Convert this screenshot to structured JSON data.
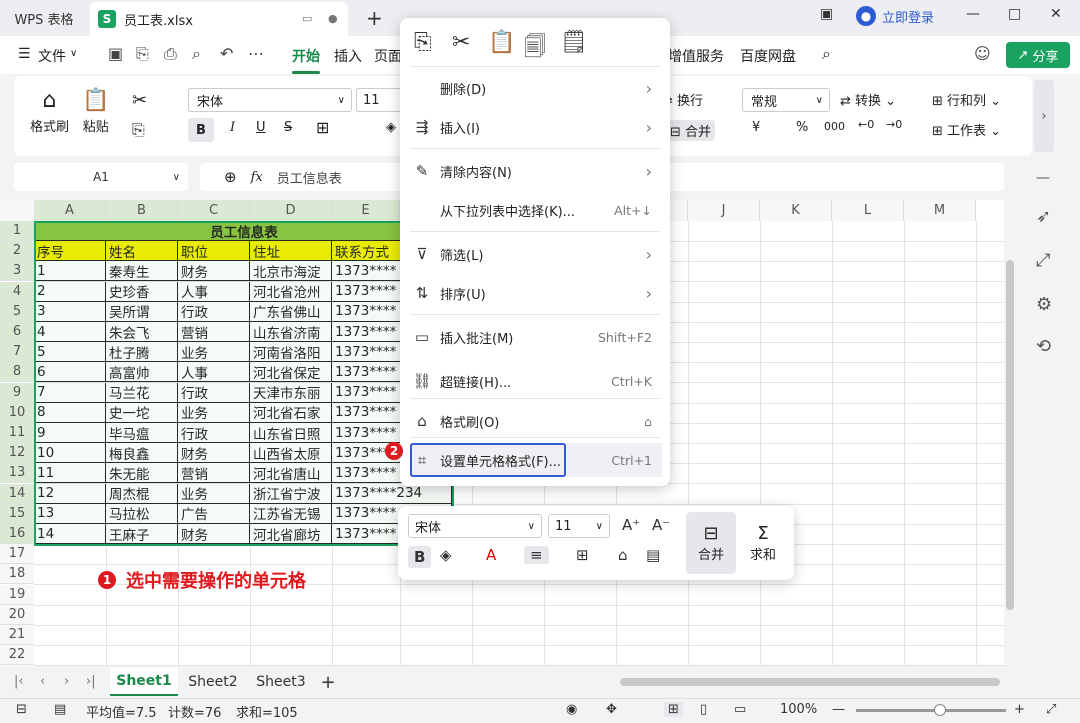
{
  "titlebar": {
    "app_tab": "WPS 表格",
    "file_tab": "员工表.xlsx",
    "file_icon": "S",
    "new_tab": "+",
    "login": "立即登录"
  },
  "menu": {
    "items": [
      "文件",
      "开始",
      "插入",
      "页面",
      "增值服务",
      "百度网盘"
    ],
    "active": "开始",
    "share": "分享"
  },
  "ribbon": {
    "format_painter": "格式刷",
    "paste": "粘贴",
    "font_name": "宋体",
    "font_size": "11",
    "wrap": "换行",
    "merge": "合并",
    "number_format": "常规",
    "convert": "转换",
    "row_col": "行和列",
    "worksheet": "工作表",
    "percent": "%",
    "currency": "¥"
  },
  "formula": {
    "name_box": "A1",
    "fx": "fx",
    "content": "员工信息表"
  },
  "columns": [
    "A",
    "B",
    "C",
    "D",
    "E",
    "F",
    "G",
    "H",
    "I",
    "J",
    "K",
    "L",
    "M"
  ],
  "rows": [
    "1",
    "2",
    "3",
    "4",
    "5",
    "6",
    "7",
    "8",
    "9",
    "10",
    "11",
    "12",
    "13",
    "14",
    "15",
    "16",
    "17",
    "18",
    "19",
    "20",
    "21",
    "22"
  ],
  "table": {
    "title": "员工信息表",
    "headers": [
      "序号",
      "姓名",
      "职位",
      "住址",
      "联系方式"
    ],
    "records": [
      [
        "1",
        "秦寿生",
        "财务",
        "北京市海淀",
        "1373****"
      ],
      [
        "2",
        "史珍香",
        "人事",
        "河北省沧州",
        "1373****"
      ],
      [
        "3",
        "吴所谓",
        "行政",
        "广东省佛山",
        "1373****"
      ],
      [
        "4",
        "朱会飞",
        "营销",
        "山东省济南",
        "1373****"
      ],
      [
        "5",
        "杜子腾",
        "业务",
        "河南省洛阳",
        "1373****"
      ],
      [
        "6",
        "高富帅",
        "人事",
        "河北省保定",
        "1373****"
      ],
      [
        "7",
        "马兰花",
        "行政",
        "天津市东丽",
        "1373****"
      ],
      [
        "8",
        "史一坨",
        "业务",
        "河北省石家",
        "1373****"
      ],
      [
        "9",
        "毕马瘟",
        "行政",
        "山东省日照",
        "1373****"
      ],
      [
        "10",
        "梅良鑫",
        "财务",
        "山西省太原",
        "1373****"
      ],
      [
        "11",
        "朱无能",
        "营销",
        "河北省唐山",
        "1373****"
      ],
      [
        "12",
        "周杰棍",
        "业务",
        "浙江省宁波",
        "1373****234"
      ],
      [
        "13",
        "马拉松",
        "广告",
        "江苏省无锡",
        "1373****"
      ],
      [
        "14",
        "王麻子",
        "财务",
        "河北省廊坊",
        "1373****"
      ]
    ]
  },
  "annotation": {
    "step1_badge": "1",
    "step1_text": "选中需要操作的单元格",
    "step2_badge": "2"
  },
  "context_menu": {
    "items": [
      {
        "label": "删除(D)",
        "shortcut": "",
        "submenu": true,
        "icon": "delete-icon"
      },
      {
        "label": "插入(I)",
        "shortcut": "",
        "submenu": true,
        "icon": "insert-icon"
      },
      {
        "label": "清除内容(N)",
        "shortcut": "",
        "submenu": true,
        "icon": "clear-icon"
      },
      {
        "label": "从下拉列表中选择(K)...",
        "shortcut": "Alt+↓",
        "submenu": false,
        "icon": ""
      },
      {
        "label": "筛选(L)",
        "shortcut": "",
        "submenu": true,
        "icon": "filter-icon"
      },
      {
        "label": "排序(U)",
        "shortcut": "",
        "submenu": true,
        "icon": "sort-icon"
      },
      {
        "label": "插入批注(M)",
        "shortcut": "Shift+F2",
        "submenu": false,
        "icon": "comment-icon"
      },
      {
        "label": "超链接(H)...",
        "shortcut": "Ctrl+K",
        "submenu": false,
        "icon": "link-icon"
      },
      {
        "label": "格式刷(O)",
        "shortcut": "",
        "submenu": false,
        "icon": "format-painter-icon"
      },
      {
        "label": "设置单元格格式(F)...",
        "shortcut": "Ctrl+1",
        "submenu": false,
        "icon": "cell-format-icon"
      }
    ]
  },
  "mini_toolbar": {
    "font_name": "宋体",
    "font_size": "11",
    "bold": "B",
    "merge": "合并",
    "sum": "求和"
  },
  "sheets": [
    "Sheet1",
    "Sheet2",
    "Sheet3"
  ],
  "active_sheet": "Sheet1",
  "status": {
    "average": "平均值=7.5",
    "count": "计数=76",
    "sum": "求和=105",
    "zoom": "100%"
  },
  "colors": {
    "accent": "#1aa260",
    "title_row": "#8dc63f",
    "header_row": "#f5f000",
    "annotation": "#e0191e",
    "highlight_box": "#2f5bd3"
  }
}
